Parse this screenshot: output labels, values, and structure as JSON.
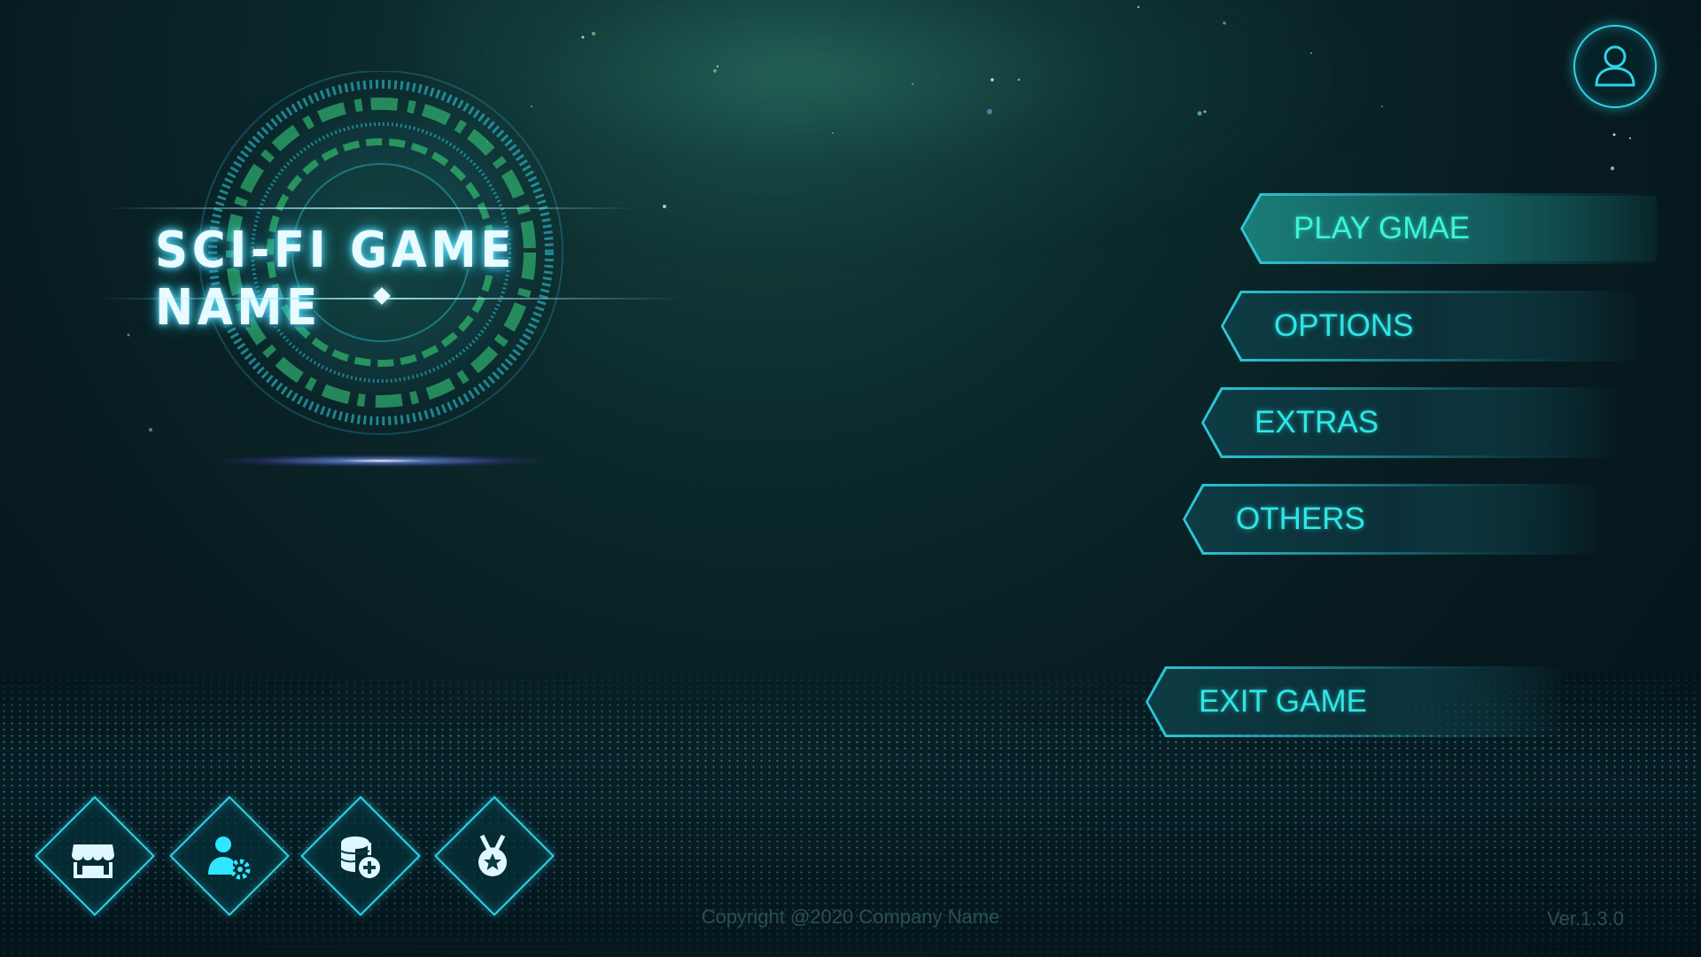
{
  "game": {
    "title": "SCI-FI GAME NAME"
  },
  "menu": {
    "items": [
      {
        "label": "PLAY GMAE",
        "active": true
      },
      {
        "label": "OPTIONS",
        "active": false
      },
      {
        "label": "EXTRAS",
        "active": false
      },
      {
        "label": "OTHERS",
        "active": false
      }
    ],
    "exit_label": "EXIT GAME"
  },
  "top_right": {
    "icon": "user-icon"
  },
  "bottom_icons": [
    "shop-icon",
    "character-settings-icon",
    "add-coins-icon",
    "achievement-medal-icon"
  ],
  "footer": {
    "copyright": "Copyright @2020 Company Name",
    "version": "Ver.1.3.0"
  },
  "colors": {
    "accent": "#2fd3e6",
    "active_label": "#3df5d0"
  }
}
